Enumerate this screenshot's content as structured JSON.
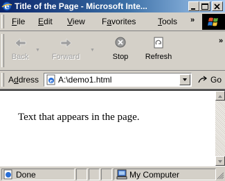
{
  "window": {
    "title": "Title of the Page - Microsoft Inte..."
  },
  "menu": {
    "items": [
      {
        "accel": "F",
        "rest": "ile"
      },
      {
        "accel": "E",
        "rest": "dit"
      },
      {
        "accel": "V",
        "rest": "iew"
      },
      {
        "pre": "F",
        "accel": "a",
        "rest": "vorites"
      },
      {
        "accel": "T",
        "rest": "ools"
      }
    ],
    "overflow": "»"
  },
  "toolbar": {
    "back_label": "Back",
    "forward_label": "Forward",
    "stop_label": "Stop",
    "refresh_label": "Refresh",
    "overflow": "»"
  },
  "address": {
    "label_pre": "A",
    "label_accel": "d",
    "label_rest": "dress",
    "value": "A:\\demo1.html",
    "go_label": "Go"
  },
  "content": {
    "text": "Text that appears in the page."
  },
  "status": {
    "left": "Done",
    "zone": "My Computer"
  },
  "colors": {
    "titlebar_start": "#0a246a",
    "titlebar_end": "#a6caf0",
    "chrome": "#d4d0c8"
  }
}
